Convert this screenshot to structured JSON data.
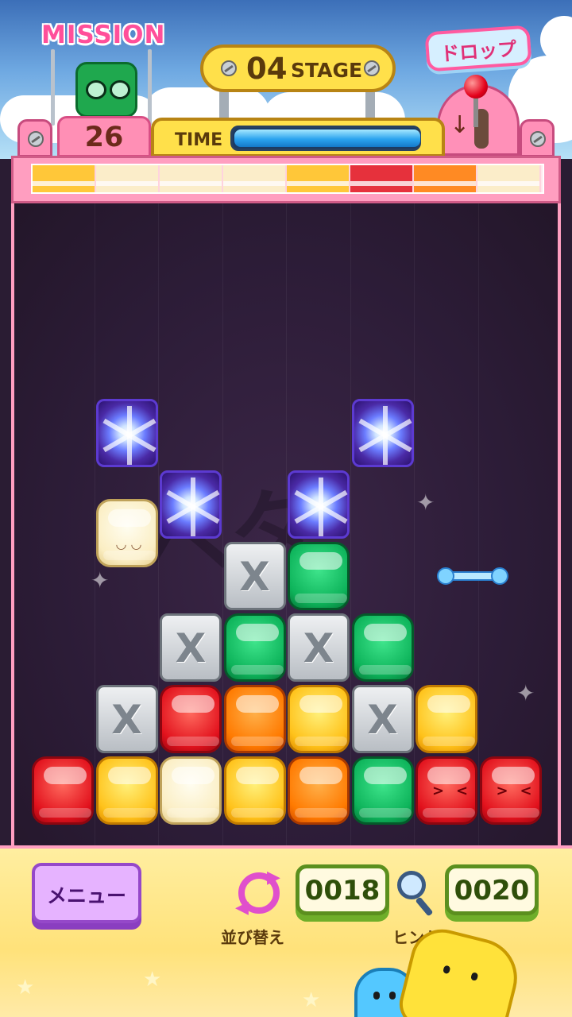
{
  "hud": {
    "mission_title": "MISSION",
    "mission_count": "26",
    "stage_number": "04",
    "stage_word": "STAGE",
    "drop_label": "ドロップ",
    "time_label": "TIME",
    "time_remaining_fraction": 0.99
  },
  "next_row": [
    "yellow",
    "cream",
    "cream",
    "cream",
    "yellow",
    "red",
    "orange",
    "cream"
  ],
  "board": {
    "blocks": [
      {
        "type": "star",
        "col": 1,
        "row": 0
      },
      {
        "type": "star",
        "col": 5,
        "row": 0
      },
      {
        "type": "star",
        "col": 2,
        "row": 1
      },
      {
        "type": "star",
        "col": 4,
        "row": 1
      },
      {
        "type": "cream-face",
        "col": 1,
        "row": 1.4
      },
      {
        "type": "stone",
        "col": 3,
        "row": 2
      },
      {
        "type": "green",
        "col": 4,
        "row": 2
      },
      {
        "type": "stone",
        "col": 2,
        "row": 3
      },
      {
        "type": "green",
        "col": 3,
        "row": 3
      },
      {
        "type": "stone",
        "col": 4,
        "row": 3
      },
      {
        "type": "green",
        "col": 5,
        "row": 3
      },
      {
        "type": "stone",
        "col": 1,
        "row": 4
      },
      {
        "type": "red",
        "col": 2,
        "row": 4
      },
      {
        "type": "orange",
        "col": 3,
        "row": 4
      },
      {
        "type": "yellow",
        "col": 4,
        "row": 4
      },
      {
        "type": "stone",
        "col": 5,
        "row": 4
      },
      {
        "type": "yellow",
        "col": 6,
        "row": 4
      },
      {
        "type": "red",
        "col": 0,
        "row": 5
      },
      {
        "type": "yellow",
        "col": 1,
        "row": 5
      },
      {
        "type": "cream",
        "col": 2,
        "row": 5
      },
      {
        "type": "yellow",
        "col": 3,
        "row": 5
      },
      {
        "type": "orange",
        "col": 4,
        "row": 5
      },
      {
        "type": "green",
        "col": 5,
        "row": 5
      },
      {
        "type": "red-char",
        "col": 6,
        "row": 5
      },
      {
        "type": "red-char",
        "col": 7,
        "row": 5
      }
    ],
    "stone_mark": "X"
  },
  "bottom": {
    "menu_label": "メニュー",
    "shuffle_label": "並び替え",
    "shuffle_count": "0018",
    "hint_label": "ヒント",
    "hint_count": "0020"
  },
  "icons": {
    "shuffle": "shuffle-icon",
    "hint": "magnifier-icon",
    "drop_lever": "lever-icon"
  },
  "colors": {
    "red": "#e2121d",
    "yellow": "#ffc21a",
    "orange": "#ff7a00",
    "green": "#0db35a",
    "cream": "#fbeec3",
    "accent_pink": "#ff9ec0"
  }
}
